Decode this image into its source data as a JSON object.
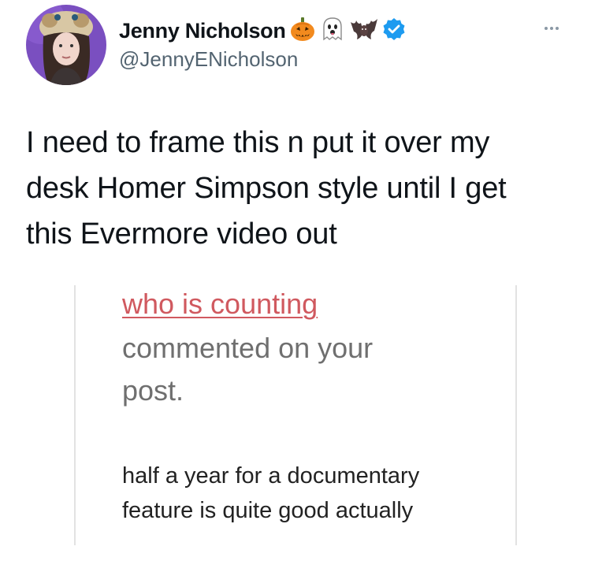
{
  "author": {
    "display_name": "Jenny Nicholson",
    "handle": "@JennyENicholson",
    "name_emojis": [
      "jack-o-lantern-icon",
      "ghost-icon",
      "bat-icon"
    ],
    "verified": true
  },
  "tweet": {
    "text_lines": [
      "I need to frame this n put it over my",
      "desk Homer Simpson style until I get",
      "this Evermore video out"
    ]
  },
  "embedded_image": {
    "commenter_name": "who is counting",
    "commented_lines": [
      "commented on your",
      "post."
    ],
    "comment_lines": [
      "half a year for a documentary",
      "feature is quite good actually"
    ]
  },
  "colors": {
    "text": "#0f1419",
    "secondary": "#536471",
    "verified_blue": "#1d9bf0",
    "tumblr_link_red": "#d0595f",
    "tumblr_grey": "#6f6f6f"
  }
}
